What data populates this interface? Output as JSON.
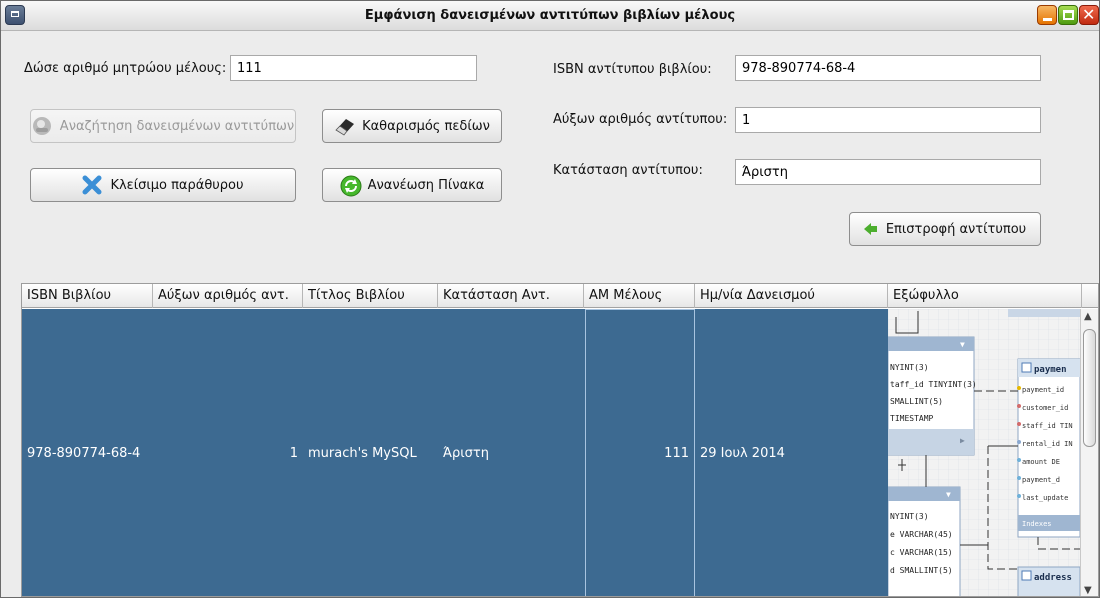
{
  "window": {
    "title": "Εμφάνιση δανεισμένων αντιτύπων βιβλίων μέλους"
  },
  "form": {
    "member_label": "Δώσε αριθμό μητρώου μέλους:",
    "member_value": "111",
    "isbn_label": "ISBN αντίτυπου βιβλίου:",
    "isbn_value": "978-890774-68-4",
    "serial_label": "Αύξων αριθμός αντίτυπου:",
    "serial_value": "1",
    "condition_label": "Κατάσταση αντίτυπου:",
    "condition_value": "Άριστη"
  },
  "buttons": {
    "search": "Αναζήτηση δανεισμένων αντιτύπων",
    "clear": "Καθαρισμός πεδίων",
    "close": "Κλείσιμο παράθυρου",
    "refresh": "Ανανέωση Πίνακα",
    "return": "Επιστροφή αντίτυπου"
  },
  "table": {
    "columns": [
      "ISBN Βιβλίου",
      "Αύξων αριθμός αντ.",
      "Τίτλος Βιβλίου",
      "Κατάσταση Αντ.",
      "ΑΜ Μέλους",
      "Ημ/νία Δανεισμού",
      "Εξώφυλλο"
    ],
    "rows": [
      {
        "isbn": "978-890774-68-4",
        "serial": "1",
        "title": "murach's MySQL",
        "condition": "Άριστη",
        "member": "111",
        "date": "29 Ιουλ 2014"
      }
    ]
  },
  "cover_image": {
    "lines": [
      "NYINT(3)",
      "taff_id TINYINT(3)",
      "SMALLINT(5)",
      "TIMESTAMP",
      "NYINT(3)",
      "e VARCHAR(45)",
      "c VARCHAR(15)",
      "d SMALLINT(5)"
    ],
    "right_lines": [
      "payment_id",
      "customer_id",
      "staff_id TIN",
      "rental_id IN",
      "amount DE",
      "payment_d",
      "last_update"
    ],
    "table1": "paymen",
    "table2": "address",
    "indexes": "Indexes"
  }
}
